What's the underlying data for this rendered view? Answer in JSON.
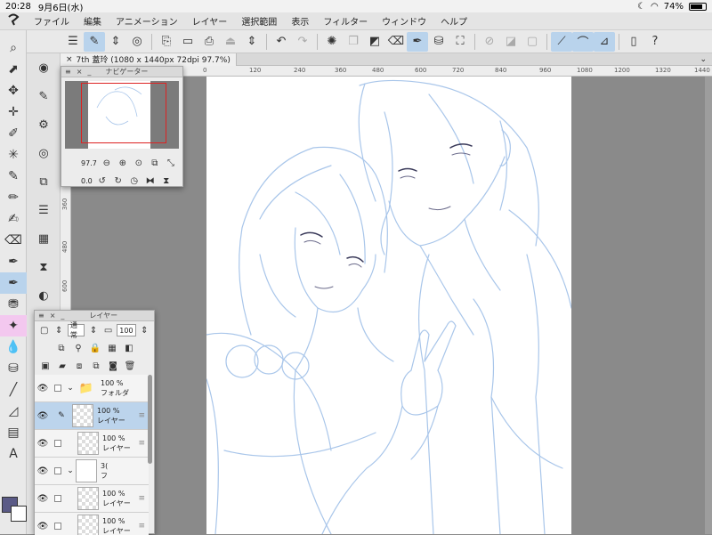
{
  "status": {
    "time": "20:28",
    "date": "9月6日(水)",
    "battery": "74%"
  },
  "menu": [
    "ファイル",
    "編集",
    "アニメーション",
    "レイヤー",
    "選択範囲",
    "表示",
    "フィルター",
    "ウィンドウ",
    "ヘルプ"
  ],
  "tab": {
    "title": "7th 蓋玲 (1080 x 1440px 72dpi 97.7%)"
  },
  "ruler": {
    "h": [
      "0",
      "120",
      "240",
      "360",
      "480",
      "600",
      "720",
      "840",
      "960",
      "1080",
      "1200",
      "1320",
      "1440"
    ],
    "v": [
      "360",
      "480",
      "600"
    ]
  },
  "navigator": {
    "title": "ナビゲーター",
    "zoom": "97.7",
    "rotation": "0.0"
  },
  "layers": {
    "title": "レイヤー",
    "blend_mode": "通常",
    "opacity": "100",
    "items": [
      {
        "opacity": "100 %",
        "name": "フォルダ",
        "type": "folder"
      },
      {
        "opacity": "100 %",
        "name": "レイヤー",
        "type": "layer",
        "selected": true
      },
      {
        "opacity": "100 %",
        "name": "レイヤー",
        "type": "layer"
      },
      {
        "opacity": "3(",
        "name": "フ",
        "type": "folder"
      },
      {
        "opacity": "100 %",
        "name": "レイヤー",
        "type": "layer"
      },
      {
        "opacity": "100 %",
        "name": "レイヤー",
        "type": "layer"
      }
    ]
  },
  "colors": {
    "main": "#5a5a86",
    "sub": "#ffffff",
    "accent": "#b9d3ec",
    "sketch": "#a9c6ea"
  }
}
